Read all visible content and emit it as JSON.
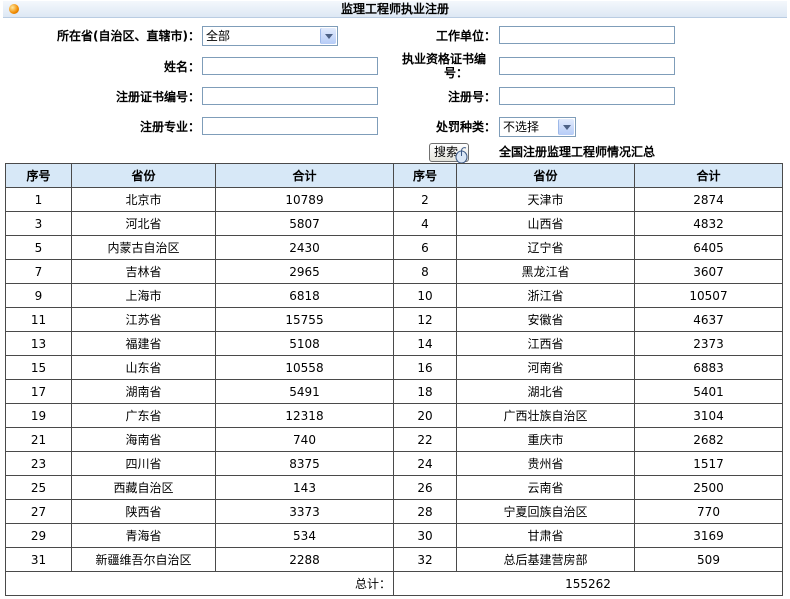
{
  "header": {
    "title": "监理工程师执业注册"
  },
  "form": {
    "province": {
      "label": "所在省(自治区、直辖市)：",
      "value": "全部"
    },
    "work_unit": {
      "label": "工作单位：",
      "value": ""
    },
    "name": {
      "label": "姓名：",
      "value": ""
    },
    "qual_cert": {
      "label_line1": "执业资格证书编",
      "label_line2": "号：",
      "value": ""
    },
    "reg_cert": {
      "label": "注册证书编号：",
      "value": ""
    },
    "reg_no": {
      "label": "注册号：",
      "value": ""
    },
    "specialty": {
      "label": "注册专业：",
      "value": ""
    },
    "penalty": {
      "label": "处罚种类：",
      "value": "不选择"
    },
    "search_label": "搜索"
  },
  "summary_title": "全国注册监理工程师情况汇总",
  "table": {
    "headers": [
      "序号",
      "省份",
      "合计",
      "序号",
      "省份",
      "合计"
    ],
    "rows": [
      [
        "1",
        "北京市",
        "10789",
        "2",
        "天津市",
        "2874"
      ],
      [
        "3",
        "河北省",
        "5807",
        "4",
        "山西省",
        "4832"
      ],
      [
        "5",
        "内蒙古自治区",
        "2430",
        "6",
        "辽宁省",
        "6405"
      ],
      [
        "7",
        "吉林省",
        "2965",
        "8",
        "黑龙江省",
        "3607"
      ],
      [
        "9",
        "上海市",
        "6818",
        "10",
        "浙江省",
        "10507"
      ],
      [
        "11",
        "江苏省",
        "15755",
        "12",
        "安徽省",
        "4637"
      ],
      [
        "13",
        "福建省",
        "5108",
        "14",
        "江西省",
        "2373"
      ],
      [
        "15",
        "山东省",
        "10558",
        "16",
        "河南省",
        "6883"
      ],
      [
        "17",
        "湖南省",
        "5491",
        "18",
        "湖北省",
        "5401"
      ],
      [
        "19",
        "广东省",
        "12318",
        "20",
        "广西壮族自治区",
        "3104"
      ],
      [
        "21",
        "海南省",
        "740",
        "22",
        "重庆市",
        "2682"
      ],
      [
        "23",
        "四川省",
        "8375",
        "24",
        "贵州省",
        "1517"
      ],
      [
        "25",
        "西藏自治区",
        "143",
        "26",
        "云南省",
        "2500"
      ],
      [
        "27",
        "陕西省",
        "3373",
        "28",
        "宁夏回族自治区",
        "770"
      ],
      [
        "29",
        "青海省",
        "534",
        "30",
        "甘肃省",
        "3169"
      ],
      [
        "31",
        "新疆维吾尔自治区",
        "2288",
        "32",
        "总后基建营房部",
        "509"
      ]
    ],
    "total_label": "总计：",
    "total_value": "155262"
  }
}
